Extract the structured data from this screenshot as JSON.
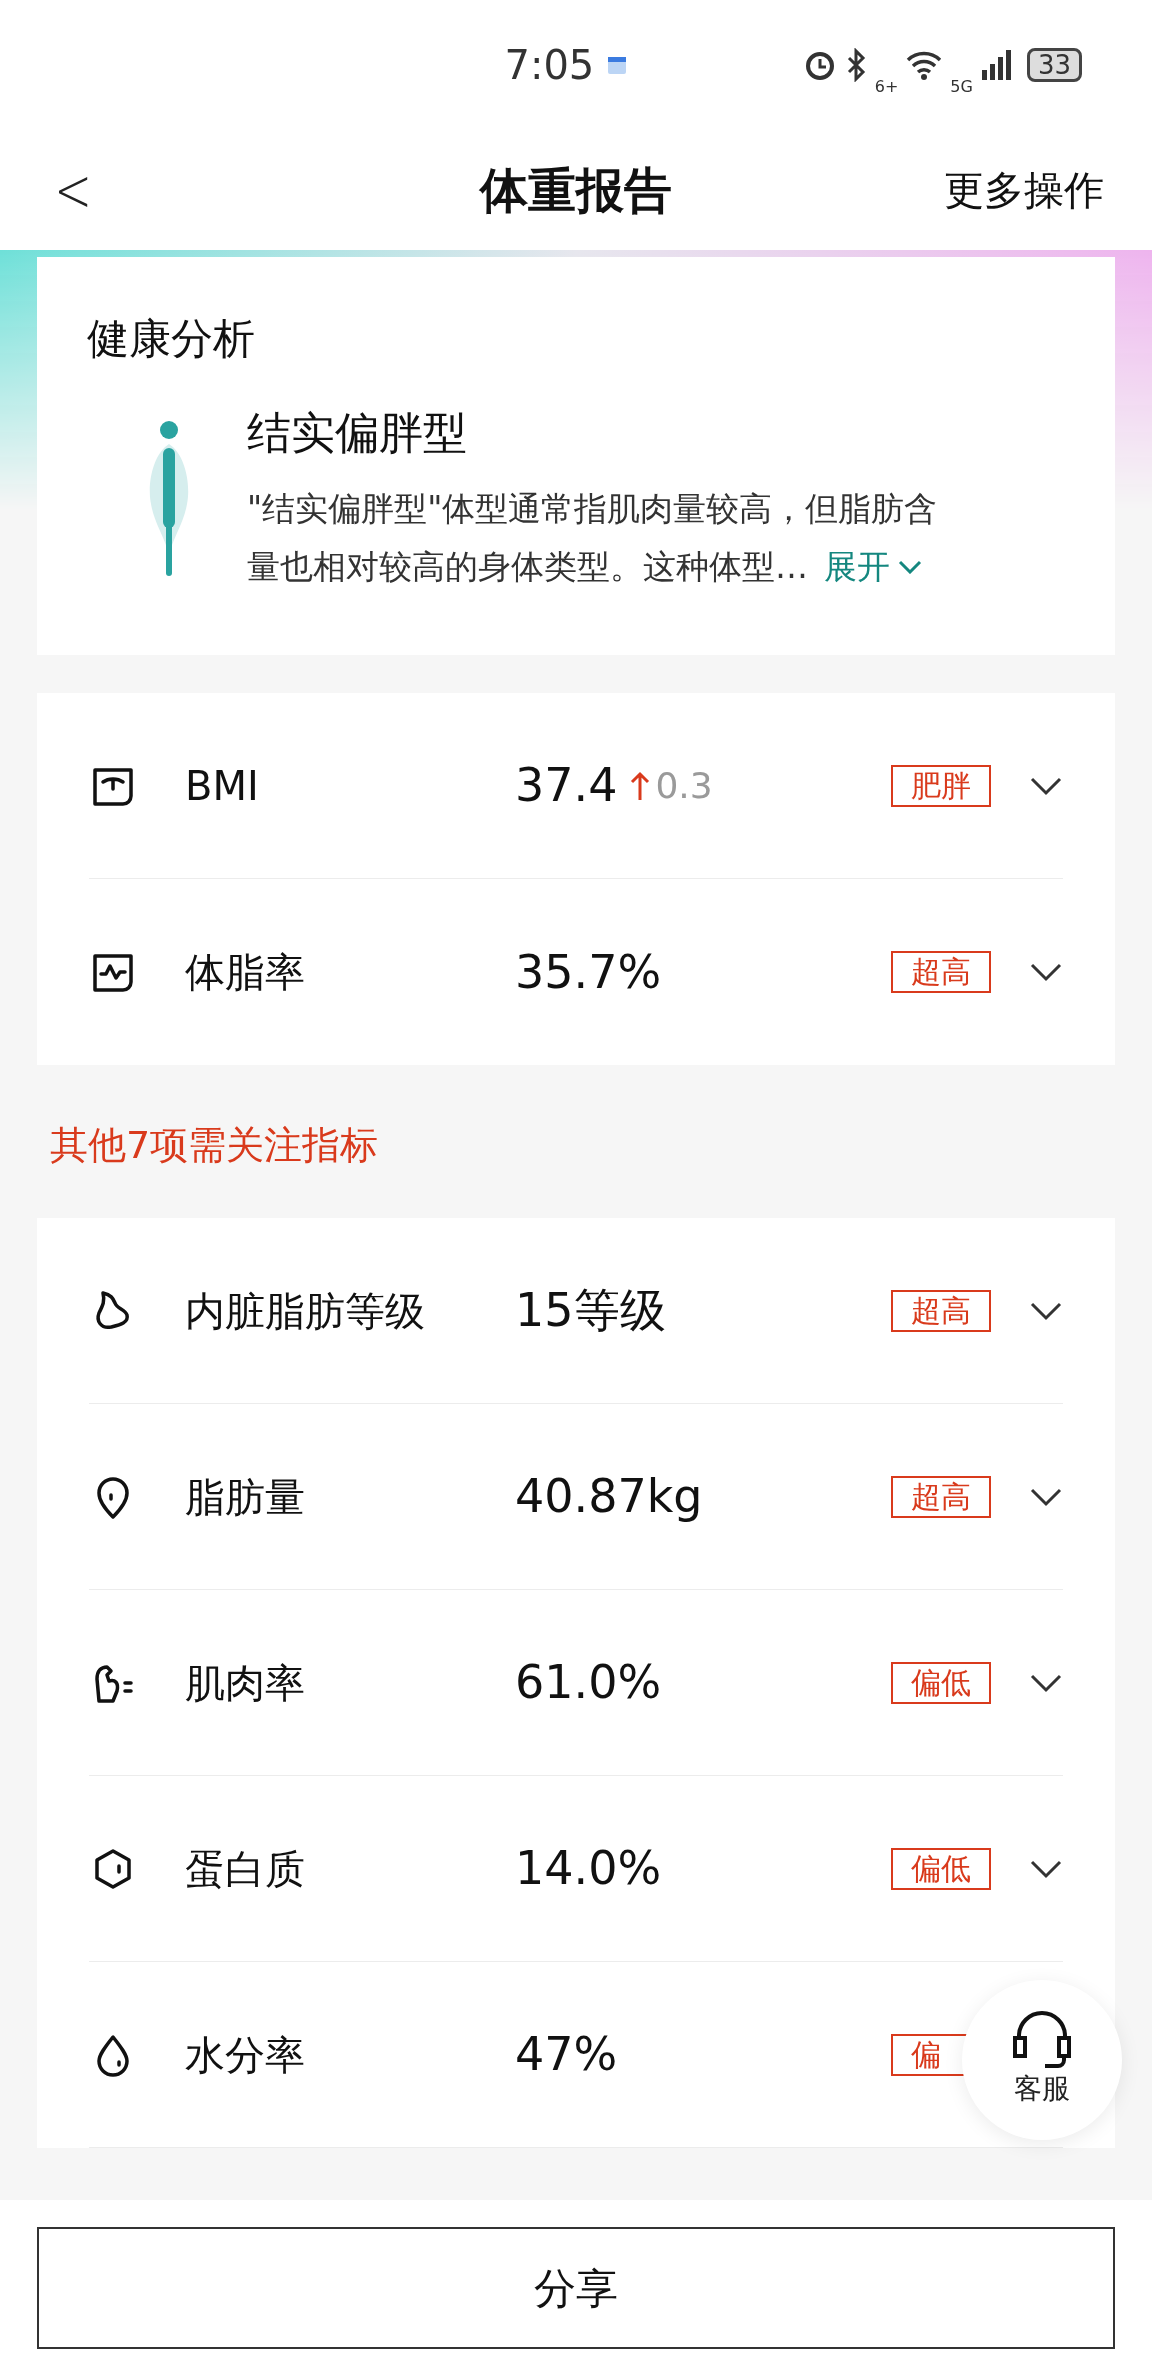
{
  "status_bar": {
    "time": "7:05",
    "wifi_label": "6+",
    "network": "5G",
    "battery": "33"
  },
  "header": {
    "back": "<",
    "title": "体重报告",
    "action": "更多操作"
  },
  "analysis": {
    "title": "健康分析",
    "type_name": "结实偏胖型",
    "description_lines": [
      "\"结实偏胖型\"体型通常指肌肉量较高，但脂肪含",
      "量也相对较高的身体类型。这种体型…"
    ],
    "expand": "展开"
  },
  "main_metrics": [
    {
      "kind": "bmi",
      "name": "BMI",
      "value": "37.4",
      "change": "0.3",
      "tag": "肥胖"
    },
    {
      "kind": "bodyfat",
      "name": "体脂率",
      "value": "35.7%",
      "tag": "超高"
    }
  ],
  "section_title": "其他7项需关注指标",
  "other_metrics": [
    {
      "kind": "visceral",
      "name": "内脏脂肪等级",
      "value": "15等级",
      "tag": "超高"
    },
    {
      "kind": "fat",
      "name": "脂肪量",
      "value": "40.87kg",
      "tag": "超高"
    },
    {
      "kind": "muscle",
      "name": "肌肉率",
      "value": "61.0%",
      "tag": "偏低"
    },
    {
      "kind": "protein",
      "name": "蛋白质",
      "value": "14.0%",
      "tag": "偏低"
    },
    {
      "kind": "water",
      "name": "水分率",
      "value": "47%",
      "tag": "偏"
    }
  ],
  "support": {
    "label": "客服"
  },
  "share_button": "分享"
}
